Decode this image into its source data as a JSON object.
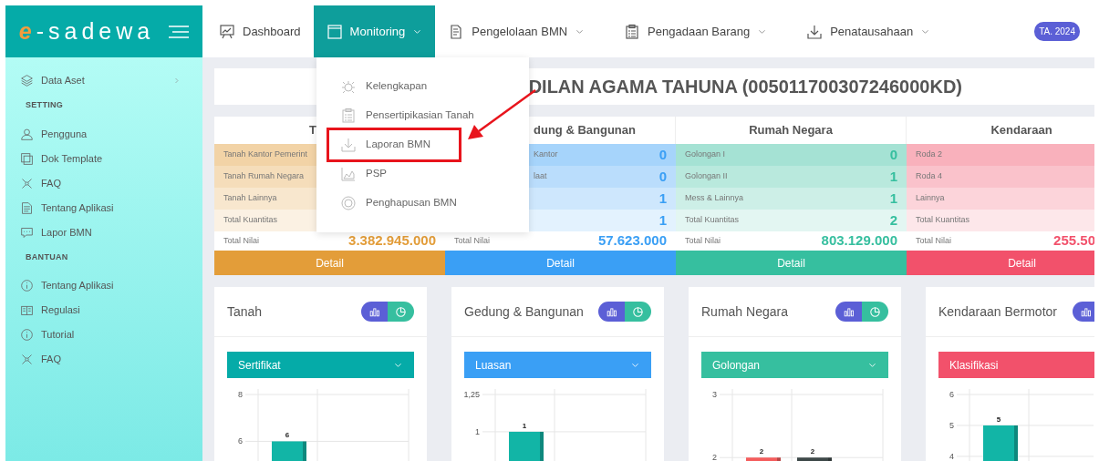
{
  "brand": {
    "initial": "e",
    "rest": "-sadewa"
  },
  "nav": [
    {
      "label": "Dashboard",
      "selected": false,
      "dropdown": false
    },
    {
      "label": "Monitoring",
      "selected": true,
      "dropdown": true
    },
    {
      "label": "Pengelolaan BMN",
      "selected": false,
      "dropdown": true
    },
    {
      "label": "Pengadaan Barang",
      "selected": false,
      "dropdown": true
    },
    {
      "label": "Penatausahaan",
      "selected": false,
      "dropdown": true
    }
  ],
  "year_badge": "TA. 2024",
  "sidebar": [
    {
      "kind": "item",
      "label": "Data Aset",
      "expandable": true
    },
    {
      "kind": "header",
      "label": "SETTING"
    },
    {
      "kind": "item",
      "label": "Pengguna",
      "expandable": false
    },
    {
      "kind": "item",
      "label": "Dok Template",
      "expandable": false
    },
    {
      "kind": "item",
      "label": "FAQ",
      "expandable": false
    },
    {
      "kind": "item",
      "label": "Tentang Aplikasi",
      "expandable": false
    },
    {
      "kind": "item",
      "label": "Lapor BMN",
      "expandable": false
    },
    {
      "kind": "header",
      "label": "BANTUAN"
    },
    {
      "kind": "item",
      "label": "Tentang Aplikasi",
      "expandable": false
    },
    {
      "kind": "item",
      "label": "Regulasi",
      "expandable": false
    },
    {
      "kind": "item",
      "label": "Tutorial",
      "expandable": false
    },
    {
      "kind": "item",
      "label": "FAQ",
      "expandable": false
    }
  ],
  "dropdown": {
    "items": [
      {
        "label": "Kelengkapan",
        "highlighted": false
      },
      {
        "label": "Pensertipikasian Tanah",
        "highlighted": false
      },
      {
        "label": "Laporan BMN",
        "highlighted": true
      },
      {
        "label": "PSP",
        "highlighted": false
      },
      {
        "label": "Penghapusan BMN",
        "highlighted": false
      }
    ]
  },
  "title": "DILAN AGAMA TAHUNA (005011700307246000KD)",
  "summary": [
    {
      "header": "T",
      "color": "#e39d39",
      "rows": [
        {
          "label": "Tanah Kantor Pemerint"
        },
        {
          "label": "Tanah Rumah Negara"
        },
        {
          "label": "Tanah Lainnya"
        },
        {
          "label": "Total Kuantitas"
        }
      ],
      "total_label": "Total Nilai",
      "total": "3.382.945.000",
      "button": "Detail"
    },
    {
      "header": "dung & Bangunan",
      "color": "#3a9ff5",
      "rows": [
        {
          "label": "Kantor",
          "value": "0"
        },
        {
          "label": "laat",
          "value": "0"
        },
        {
          "value": "1"
        },
        {
          "value": "1"
        }
      ],
      "total_label": "Total Nilai",
      "total": "57.623.000",
      "button": "Detail"
    },
    {
      "header": "Rumah Negara",
      "color": "#36bf9f",
      "rows": [
        {
          "label": "Golongan I",
          "value": "0"
        },
        {
          "label": "Golongan II",
          "value": "1"
        },
        {
          "label": "Mess & Lainnya",
          "value": "1"
        },
        {
          "label": "Total Kuantitas",
          "value": "2"
        }
      ],
      "total_label": "Total Nilai",
      "total": "803.129.000",
      "button": "Detail"
    },
    {
      "header": "Kendaraan",
      "color": "#f2516b",
      "rows": [
        {
          "label": "Roda 2"
        },
        {
          "label": "Roda 4"
        },
        {
          "label": "Lainnya"
        },
        {
          "label": "Total Kuantitas"
        }
      ],
      "total_label": "Total Nilai",
      "total": "255.50",
      "button": "Detail"
    }
  ],
  "charts": [
    {
      "title": "Tanah",
      "select": "Sertifikat",
      "color": "#05aba8",
      "chart_data": {
        "type": "bar",
        "categories": [
          null
        ],
        "ylim": [
          4.5,
          8
        ],
        "yticks": [
          8,
          6
        ],
        "data_labels": true,
        "series": [
          {
            "color": "#12b5a6",
            "values": [
              6
            ]
          }
        ]
      }
    },
    {
      "title": "Gedung & Bangunan",
      "select": "Luasan",
      "color": "#3a9ff5",
      "chart_data": {
        "type": "bar",
        "categories": [
          null
        ],
        "ylim": [
          0.7,
          1.25
        ],
        "yticks": [
          {
            "value": 1.25,
            "label": "1,25"
          },
          1
        ],
        "data_labels": true,
        "series": [
          {
            "color": "#12b5a6",
            "values": [
              1
            ]
          }
        ]
      }
    },
    {
      "title": "Rumah Negara",
      "select": "Golongan",
      "color": "#36bf9f",
      "chart_data": {
        "type": "bar",
        "categories": [
          null,
          null
        ],
        "ylim": [
          1.7,
          3
        ],
        "yticks": [
          3,
          2
        ],
        "data_labels": true,
        "series": [
          {
            "colors": [
              "#f45c5c",
              "#3d4848"
            ],
            "values": [
              2,
              2
            ]
          }
        ]
      }
    },
    {
      "title": "Kendaraan Bermotor",
      "select": "Klasifikasi",
      "color": "#f2516b",
      "chart_data": {
        "type": "bar",
        "categories": [
          null
        ],
        "ylim": [
          3.35,
          6
        ],
        "yticks": [
          6,
          5,
          4
        ],
        "data_labels": true,
        "series": [
          {
            "color": "#12b5a6",
            "values": [
              5
            ]
          }
        ]
      }
    }
  ]
}
